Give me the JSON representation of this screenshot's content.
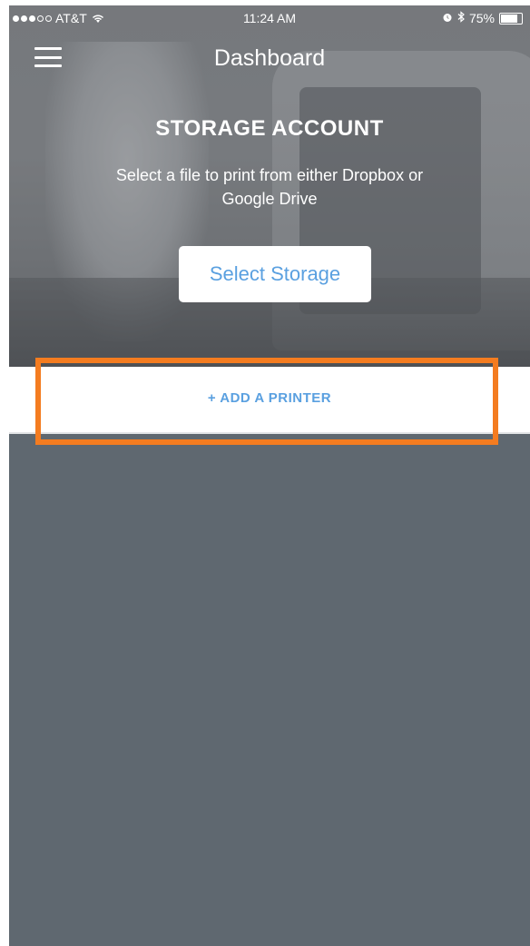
{
  "status_bar": {
    "carrier": "AT&T",
    "time": "11:24 AM",
    "battery_percent": "75%",
    "signal_bars_filled": 3,
    "signal_bars_total": 5,
    "icons": [
      "signal-icon",
      "wifi-icon",
      "alarm-icon",
      "bluetooth-icon",
      "battery-icon"
    ]
  },
  "nav": {
    "title": "Dashboard",
    "menu_icon": "hamburger-menu-icon"
  },
  "storage": {
    "heading": "STORAGE ACCOUNT",
    "description": "Select a file to print from either Dropbox or Google Drive",
    "button_label": "Select Storage"
  },
  "printers": {
    "add_label": "+ ADD A PRINTER"
  },
  "colors": {
    "accent": "#5aa0e0",
    "highlight": "#f47c20",
    "background": "#5f6870"
  }
}
